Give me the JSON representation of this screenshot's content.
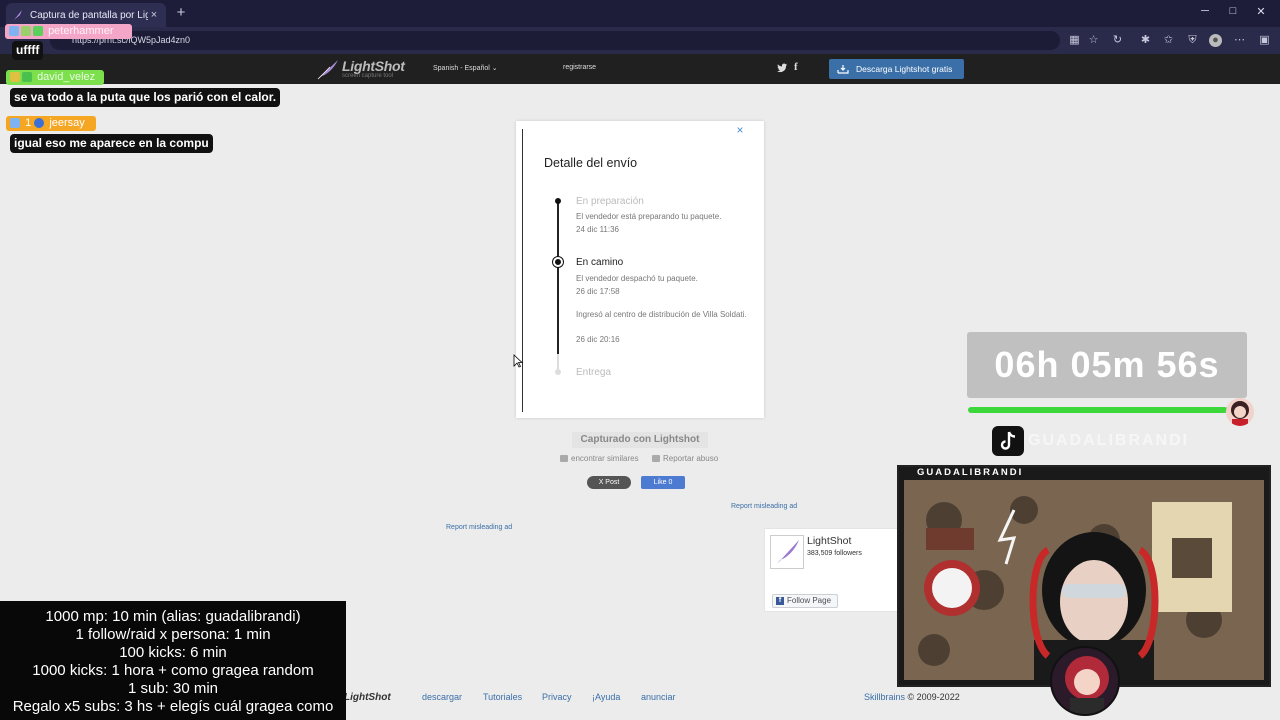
{
  "browser": {
    "tab_title": "Captura de pantalla por Lightshot",
    "tab_close": "×",
    "new_tab": "+",
    "url": "https://prnt.sc/iQW5pJad4zn0",
    "controls": {
      "minimize": "─",
      "maximize": "□",
      "close": "✕"
    }
  },
  "header": {
    "logo": "LightShot",
    "logo_sub": "screen capture tool",
    "language": "Spanish - Español",
    "register": "registrarse",
    "facebook": "f",
    "download": "Descarga Lightshot gratis"
  },
  "chat": [
    {
      "user": "peterhammer",
      "message": "uffff",
      "color": "#f4a6c8"
    },
    {
      "user": "david_velez",
      "message": "se va todo a la puta que los parió con el calor.",
      "color": "#7be04b"
    },
    {
      "user": "jeersay",
      "message": "igual eso me aparece en la compu",
      "color": "#f5a623",
      "badge_count": "1"
    }
  ],
  "card": {
    "close": "×",
    "title": "Detalle del envío",
    "steps": [
      {
        "title": "En preparación",
        "desc": "El vendedor está preparando tu paquete.",
        "date": "24 dic 11:36"
      },
      {
        "title": "En camino",
        "desc": "El vendedor despachó tu paquete.",
        "date": "26 dic 17:58",
        "desc2": "Ingresó al centro de distribución de Villa Soldati.",
        "date2": "26 dic 20:16"
      },
      {
        "title": "Entrega"
      }
    ]
  },
  "captured": "Capturado con Lightshot",
  "actions": {
    "similar": "encontrar similares",
    "report": "Reportar abuso"
  },
  "social": {
    "post": "X Post",
    "like": "Like 0"
  },
  "ads": {
    "misleading_left": "Report misleading ad",
    "misleading_right": "Report misleading ad"
  },
  "fb_widget": {
    "name": "LightShot",
    "followers": "383,509 followers",
    "follow": "Follow Page"
  },
  "footer": {
    "logo": "LightShot",
    "links": [
      "descargar",
      "Tutoriales",
      "Privacy",
      "¡Ayuda",
      "anunciar"
    ],
    "company": "Skillbrains",
    "copyright": "© 2009-2022"
  },
  "stream": {
    "timer": "06h 05m 56s",
    "progress": 0.96,
    "tiktok_name": "GUADALIBRANDI",
    "cam_title": "GUADALIBRANDI",
    "rules": [
      "1000 mp: 10 min (alias: guadalibrandi)",
      "1 follow/raid x persona: 1 min",
      "100 kicks: 6 min",
      "1000 kicks: 1 hora + como gragea random",
      "1 sub: 30 min",
      "Regalo x5 subs: 3 hs + elegís cuál gragea como"
    ]
  },
  "colors": {
    "accent": "#3a6fa8",
    "progress": "#3bd73b",
    "header_bg": "#202020"
  }
}
